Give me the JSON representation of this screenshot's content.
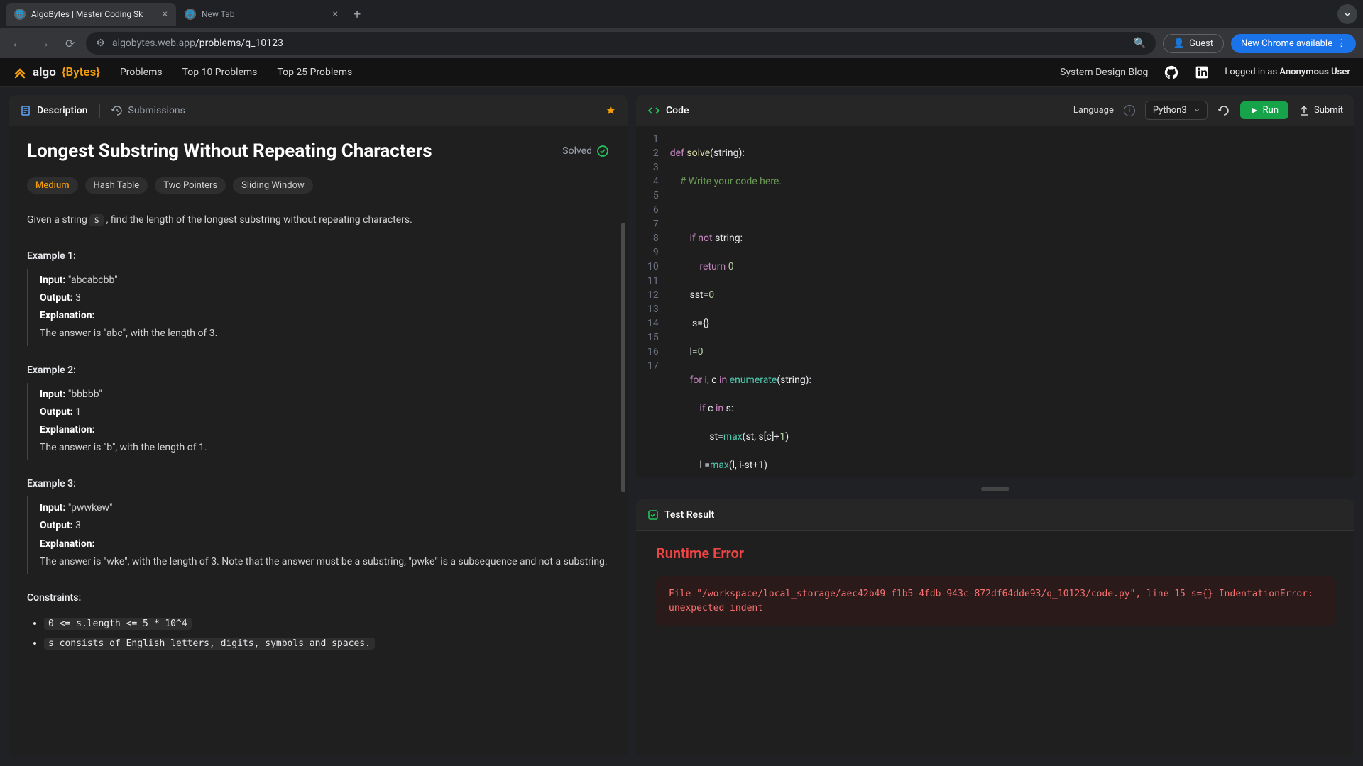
{
  "browser": {
    "tabs": [
      {
        "title": "AlgoBytes | Master Coding Sk",
        "active": true
      },
      {
        "title": "New Tab",
        "active": false
      }
    ],
    "url_prefix": "algobytes.web.app",
    "url_path": "/problems/q_10123",
    "guest_label": "Guest",
    "update_label": "New Chrome available"
  },
  "header": {
    "logo_text": "algo",
    "logo_bytes": "{Bytes}",
    "nav": [
      "Problems",
      "Top 10 Problems",
      "Top 25 Problems"
    ],
    "blog": "System Design Blog",
    "logged_prefix": "Logged in as ",
    "logged_user": "Anonymous User"
  },
  "left": {
    "tabs": {
      "description": "Description",
      "submissions": "Submissions"
    },
    "title": "Longest Substring Without Repeating Characters",
    "solved": "Solved",
    "difficulty": "Medium",
    "tags": [
      "Hash Table",
      "Two Pointers",
      "Sliding Window"
    ],
    "desc_pre": "Given a string ",
    "desc_code": "s",
    "desc_post": " , find the length of the longest substring without repeating characters.",
    "examples": [
      {
        "title": "Example 1:",
        "input": "\"abcabcbb\"",
        "output": "3",
        "explanation": "The answer is \"abc\", with the length of 3."
      },
      {
        "title": "Example 2:",
        "input": "\"bbbbb\"",
        "output": "1",
        "explanation": "The answer is \"b\", with the length of 1."
      },
      {
        "title": "Example 3:",
        "input": "\"pwwkew\"",
        "output": "3",
        "explanation": "The answer is \"wke\", with the length of 3. Note that the answer must be a substring, \"pwke\" is a subsequence and not a substring."
      }
    ],
    "labels": {
      "input": "Input:",
      "output": "Output:",
      "explanation": "Explanation:"
    },
    "constraints_title": "Constraints:",
    "constraints": [
      "0 <= s.length <= 5 * 10^4",
      "s consists of English letters, digits, symbols and spaces."
    ]
  },
  "code": {
    "header": "Code",
    "lang_label": "Language",
    "lang_value": "Python3",
    "run": "Run",
    "submit": "Submit",
    "lines": 17
  },
  "result": {
    "header": "Test Result",
    "title": "Runtime Error",
    "message": "File \"/workspace/local_storage/aec42b49-f1b5-4fdb-943c-872df64dde93/q_10123/code.py\", line 15 s={} IndentationError: unexpected indent"
  }
}
